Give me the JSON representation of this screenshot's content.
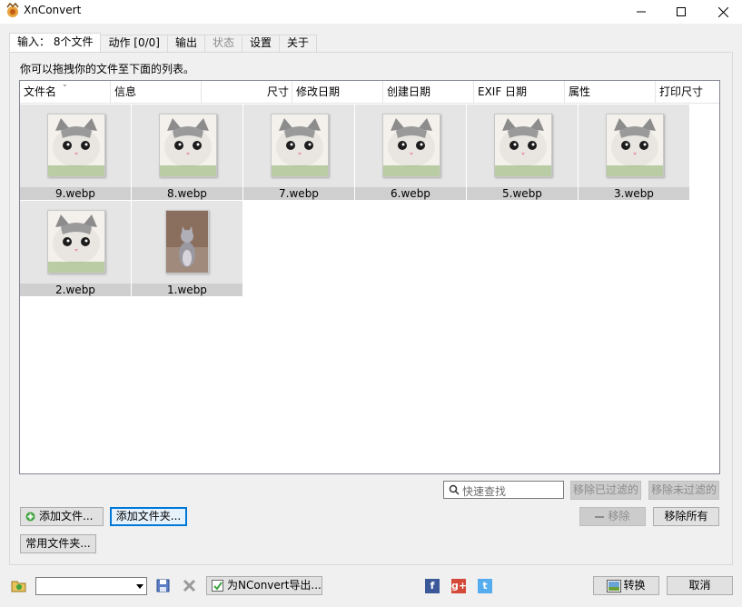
{
  "window": {
    "title": "XnConvert",
    "minimize_glyph": "—",
    "maximize_glyph": "☐",
    "close_glyph": "✕"
  },
  "tabs": [
    {
      "label": "输入： 8个文件",
      "active": true
    },
    {
      "label": "动作 [0/0]",
      "active": false
    },
    {
      "label": "输出",
      "active": false
    },
    {
      "label": "状态",
      "active": false,
      "disabled": true
    },
    {
      "label": "设置",
      "active": false
    },
    {
      "label": "关于",
      "active": false
    }
  ],
  "input": {
    "hint": "你可以拖拽你的文件至下面的列表。",
    "columns": [
      "文件名",
      "信息",
      "尺寸",
      "修改日期",
      "创建日期",
      "EXIF 日期",
      "属性",
      "打印尺寸"
    ],
    "files": [
      {
        "name": "9.webp",
        "kind": "kitten-face"
      },
      {
        "name": "8.webp",
        "kind": "kitten-face"
      },
      {
        "name": "7.webp",
        "kind": "kitten-face"
      },
      {
        "name": "6.webp",
        "kind": "kitten-face"
      },
      {
        "name": "5.webp",
        "kind": "kitten-face"
      },
      {
        "name": "3.webp",
        "kind": "kitten-face"
      },
      {
        "name": "2.webp",
        "kind": "kitten-face"
      },
      {
        "name": "1.webp",
        "kind": "kitten-sitting"
      }
    ],
    "search_placeholder": "快速查找",
    "remove_filtered": "移除已过滤的",
    "remove_unfiltered": "移除未过滤的",
    "add_files": "添加文件...",
    "add_folder": "添加文件夹...",
    "remove": "移除",
    "remove_all": "移除所有",
    "common_folders": "常用文件夹..."
  },
  "bottom": {
    "export_label": "为NConvert导出...",
    "convert_label": "转换",
    "cancel_label": "取消",
    "preset_value": ""
  },
  "social": {
    "facebook": "f",
    "googleplus": "g+",
    "twitter": "t"
  },
  "colors": {
    "thumb_bg": "#e5e5e5",
    "label_bg": "#cfcfcf",
    "focus": "#0078d7"
  }
}
